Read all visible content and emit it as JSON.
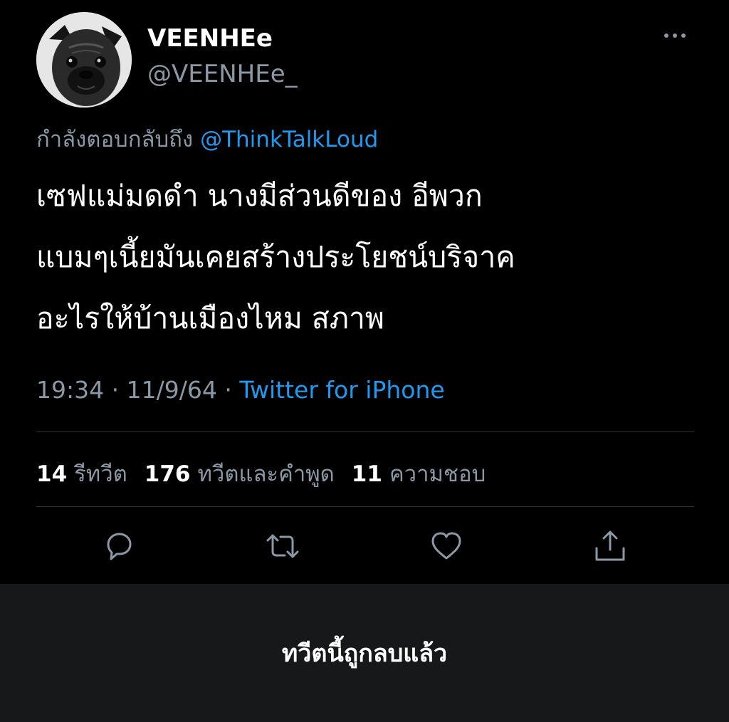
{
  "author": {
    "display_name": "VEENHEe",
    "handle": "@VEENHEe_",
    "avatar_icon": "pug-avatar"
  },
  "menu": {
    "icon": "more-horizontal-icon"
  },
  "reply": {
    "prefix": "กำลังตอบกลับถึง",
    "mention": "@ThinkTalkLoud"
  },
  "tweet": {
    "text": "เซฟแม่มดดำ นางมีส่วนดีของ อีพวก\nแบมๆเนี้ยมันเคยสร้างประโยชน์บริจาค\nอะไรให้บ้านเมืองไหม สภาพ"
  },
  "meta": {
    "time": "19:34",
    "separator1": "·",
    "date": "11/9/64",
    "separator2": "·",
    "source": "Twitter for iPhone"
  },
  "stats": {
    "retweets_count": "14",
    "retweets_label": "รีทวีต",
    "quotes_count": "176",
    "quotes_label": "ทวีตและคำพูด",
    "likes_count": "11",
    "likes_label": "ความชอบ"
  },
  "actions": [
    {
      "icon": "reply-icon"
    },
    {
      "icon": "retweet-icon"
    },
    {
      "icon": "like-icon"
    },
    {
      "icon": "share-icon"
    }
  ],
  "footer": {
    "deleted_message": "ทวีตนี้ถูกลบแล้ว"
  },
  "colors": {
    "background": "#000000",
    "text_primary": "#ffffff",
    "text_secondary": "#8b98a5",
    "link": "#1d9bf0",
    "divider": "#2f3336",
    "footer_background": "#17181a"
  }
}
